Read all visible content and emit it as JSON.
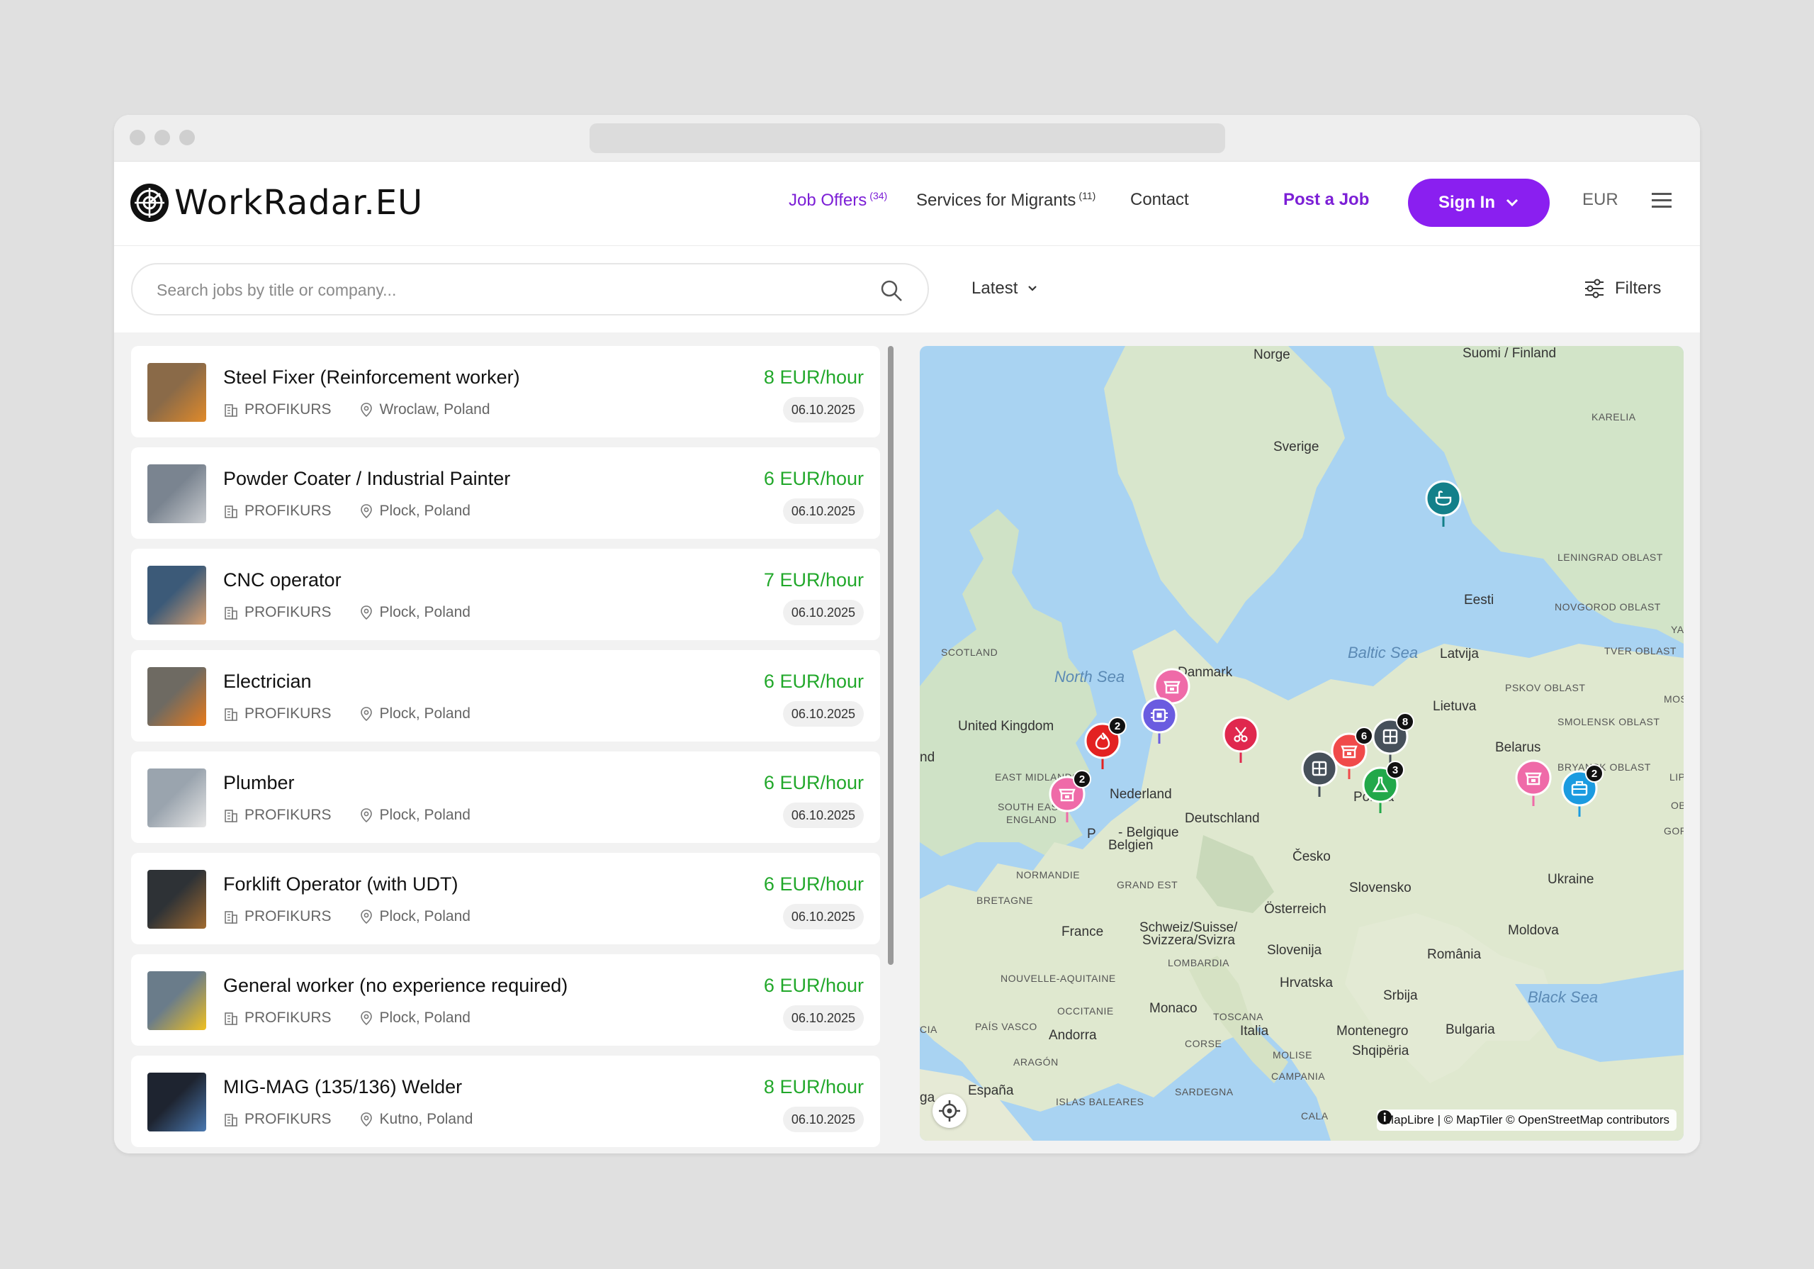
{
  "header": {
    "logo": "WorkRadar.EU",
    "nav": [
      {
        "label": "Job Offers",
        "count": "(34)"
      },
      {
        "label": "Services for Migrants",
        "count": "(11)"
      },
      {
        "label": "Contact",
        "count": ""
      }
    ],
    "post_job": "Post a Job",
    "sign_in": "Sign In",
    "currency": "EUR"
  },
  "toolbar": {
    "search_placeholder": "Search jobs by title or company...",
    "sort": "Latest",
    "filters": "Filters"
  },
  "jobs": [
    {
      "title": "Steel Fixer (Reinforcement worker)",
      "company": "PROFIKURS",
      "location": "Wroclaw, Poland",
      "pay": "8 EUR/hour",
      "date": "06.10.2025"
    },
    {
      "title": "Powder Coater / Industrial Painter",
      "company": "PROFIKURS",
      "location": "Plock, Poland",
      "pay": "6 EUR/hour",
      "date": "06.10.2025"
    },
    {
      "title": "CNC operator",
      "company": "PROFIKURS",
      "location": "Plock, Poland",
      "pay": "7 EUR/hour",
      "date": "06.10.2025"
    },
    {
      "title": "Electrician",
      "company": "PROFIKURS",
      "location": "Plock, Poland",
      "pay": "6 EUR/hour",
      "date": "06.10.2025"
    },
    {
      "title": "Plumber",
      "company": "PROFIKURS",
      "location": "Plock, Poland",
      "pay": "6 EUR/hour",
      "date": "06.10.2025"
    },
    {
      "title": "Forklift Operator (with UDT)",
      "company": "PROFIKURS",
      "location": "Plock, Poland",
      "pay": "6 EUR/hour",
      "date": "06.10.2025"
    },
    {
      "title": "General worker (no experience required)",
      "company": "PROFIKURS",
      "location": "Plock, Poland",
      "pay": "6 EUR/hour",
      "date": "06.10.2025"
    },
    {
      "title": "MIG-MAG (135/136) Welder",
      "company": "PROFIKURS",
      "location": "Kutno, Poland",
      "pay": "8 EUR/hour",
      "date": "06.10.2025"
    }
  ],
  "map": {
    "labels": {
      "norge": "Norge",
      "suomi": "Suomi / Finland",
      "karelia": "KARELIA",
      "sverige": "Sverige",
      "leningrad": "LENINGRAD OBLAST",
      "eesti": "Eesti",
      "novgorod": "NOVGOROD OBLAST",
      "yar": "YAR",
      "scotland": "SCOTLAND",
      "north_sea": "North Sea",
      "danmark": "Danmark",
      "baltic": "Baltic Sea",
      "latvija": "Latvija",
      "tver": "TVER OBLAST",
      "pskov": "PSKOV OBLAST",
      "lietuva": "Lietuva",
      "mos": "MOS",
      "uk": "United Kingdom",
      "smolensk": "SMOLENSK OBLAST",
      "belarus": "Belarus",
      "nd": "nd",
      "bryansk": "BRYANSK OBLAST",
      "lip": "LIP",
      "east_midlands": "EAST MIDLANDS",
      "nederland": "Nederland",
      "polska": "Polska",
      "obla": "OBLA",
      "south_east": "SOUTH EAST",
      "england": "ENGLAND",
      "deutschland": "Deutschland",
      "gorod": "GOROD",
      "belgique": "- Belgique",
      "belgien": "Belgien",
      "pb": "P",
      "normandie": "NORMANDIE",
      "cesko": "Česko",
      "grand_est": "GRAND EST",
      "bretagne": "BRETAGNE",
      "slovensko": "Slovensko",
      "ukraine": "Ukraine",
      "osterreich": "Österreich",
      "france": "France",
      "schweiz1": "Schweiz/Suisse/",
      "schweiz2": "Svizzera/Svizra",
      "moldova": "Moldova",
      "lombardia": "LOMBARDIA",
      "slovenija": "Slovenija",
      "romania": "România",
      "nouvelle": "NOUVELLE-AQUITAINE",
      "hrvatska": "Hrvatska",
      "srbija": "Srbija",
      "black_sea": "Black Sea",
      "occitanie": "OCCITANIE",
      "monaco": "Monaco",
      "toscana": "TOSCANA",
      "pais_vasco": "PAÍS VASCO",
      "andorra": "Andorra",
      "italia": "Italia",
      "montenegro": "Montenegro",
      "bulgaria": "Bulgaria",
      "cia": "CIA",
      "corse": "CORSE",
      "aragon": "ARAGÓN",
      "molise": "MOLISE",
      "shqiperia": "Shqipëria",
      "campania": "CAMPANIA",
      "espana": "España",
      "sardegna": "SARDEGNA",
      "islas": "ISLAS BALEARES",
      "cala": "CALA",
      "ga": "ga"
    },
    "markers": [
      {
        "icon": "bath-icon",
        "color": "#13808a",
        "count": ""
      },
      {
        "icon": "store-icon",
        "color": "#ef6aa8",
        "count": ""
      },
      {
        "icon": "chip-icon",
        "color": "#6a5ce0",
        "count": ""
      },
      {
        "icon": "flame-icon",
        "color": "#e32222",
        "count": "2"
      },
      {
        "icon": "scissors-icon",
        "color": "#e0284e",
        "count": ""
      },
      {
        "icon": "window-icon",
        "color": "#46505a",
        "count": "8"
      },
      {
        "icon": "store-icon",
        "color": "#f04a4a",
        "count": "6"
      },
      {
        "icon": "window-icon",
        "color": "#46505a",
        "count": ""
      },
      {
        "icon": "flask-icon",
        "color": "#22a84a",
        "count": "3"
      },
      {
        "icon": "store-icon",
        "color": "#ef6aa8",
        "count": "2"
      },
      {
        "icon": "store-icon",
        "color": "#ef6aa8",
        "count": ""
      },
      {
        "icon": "toolbox-icon",
        "color": "#1b9be0",
        "count": "2"
      }
    ],
    "attribution": "MapLibre | © MapTiler © OpenStreetMap contributors"
  },
  "colors": {
    "brand": "#8a1ff0",
    "pay": "#22a82b",
    "active_nav": "#7c1fd6"
  }
}
